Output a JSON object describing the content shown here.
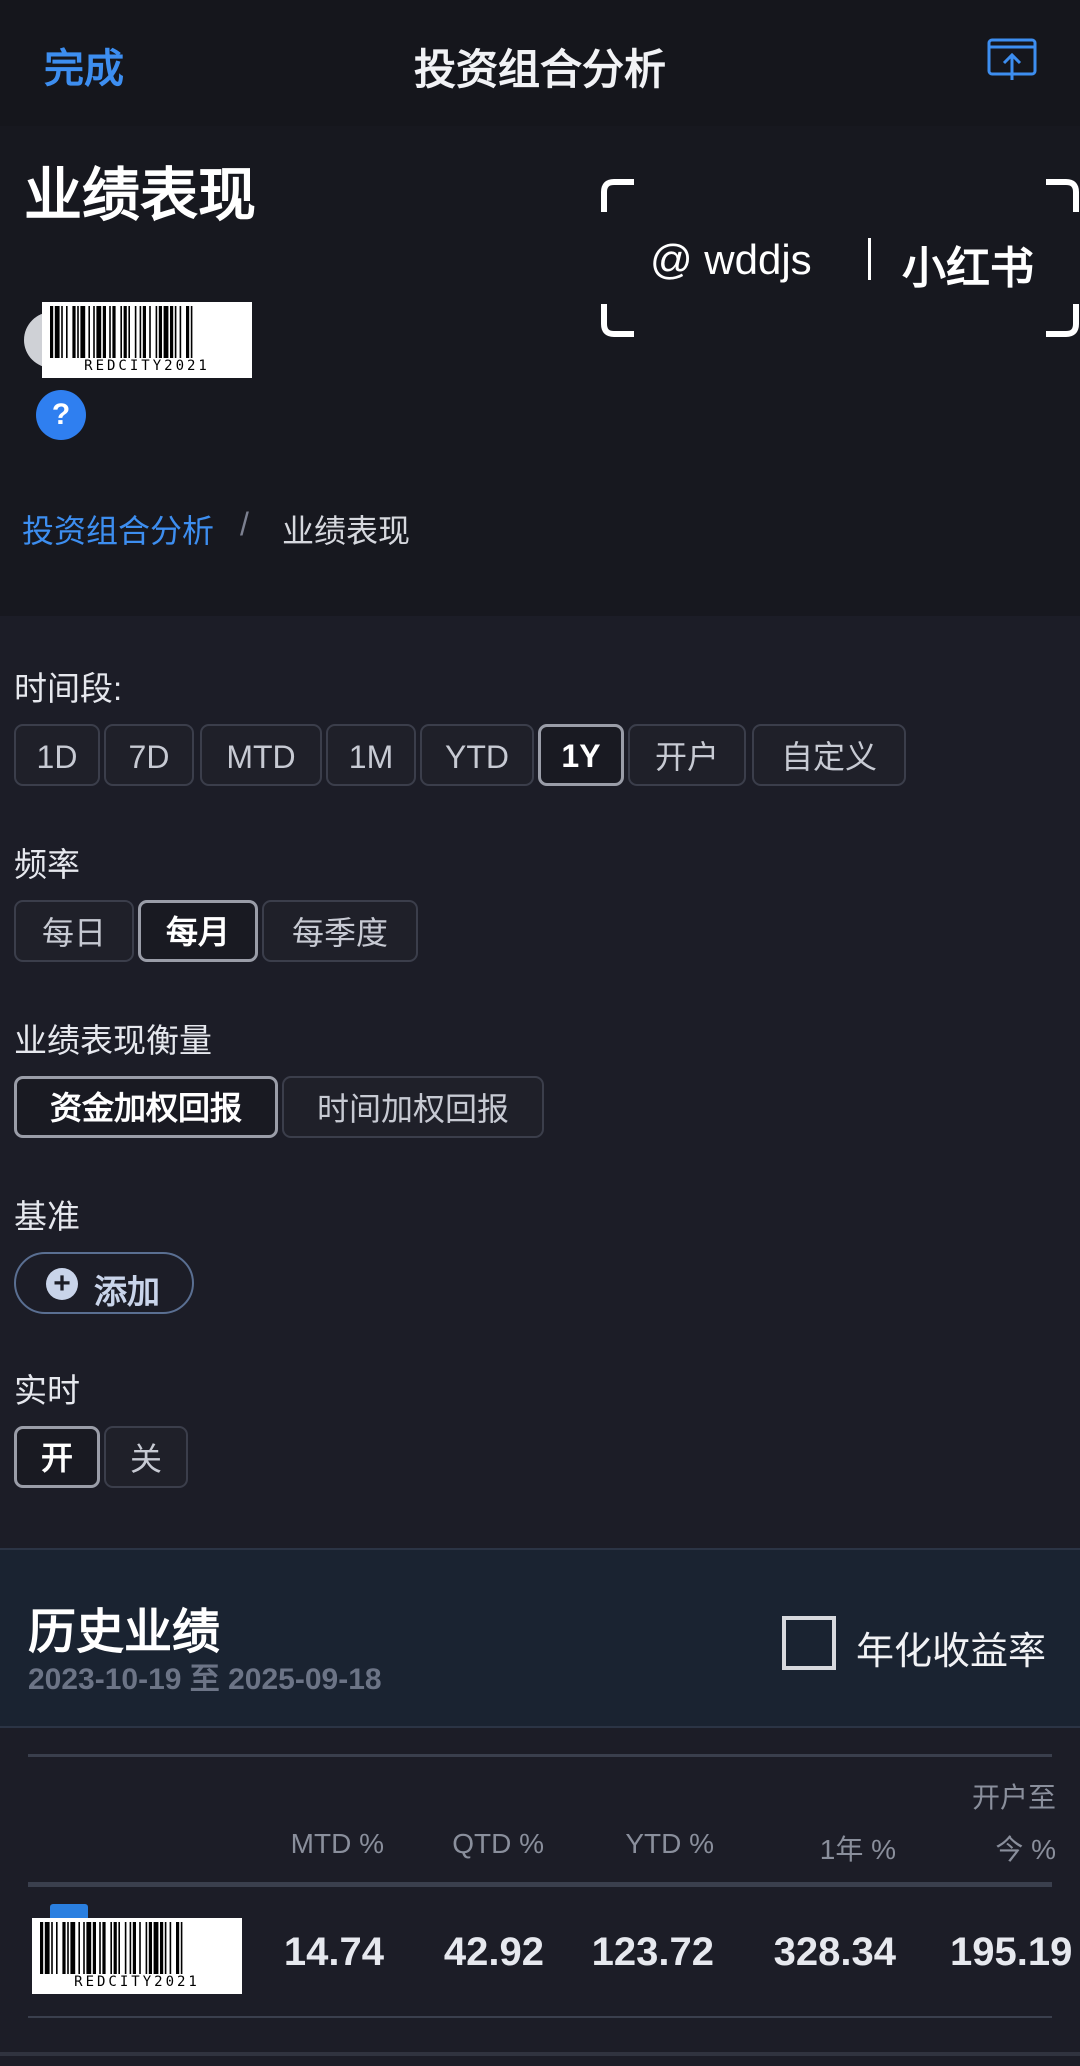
{
  "nav": {
    "done_label": "完成",
    "title": "投资组合分析",
    "share_icon": "share-screen-icon"
  },
  "header": {
    "title": "业绩表现",
    "barcode_text": "REDCITY2021",
    "help_label": "?",
    "breadcrumb": {
      "parent": "投资组合分析",
      "separator": "/",
      "current": "业绩表现"
    }
  },
  "watermark": {
    "handle": "@ wddjs",
    "brand": "小红书"
  },
  "filters": {
    "period": {
      "label": "时间段:",
      "options": [
        "1D",
        "7D",
        "MTD",
        "1M",
        "YTD",
        "1Y",
        "开户",
        "自定义"
      ],
      "selected": "1Y"
    },
    "frequency": {
      "label": "频率",
      "options": [
        "每日",
        "每月",
        "每季度"
      ],
      "selected": "每月"
    },
    "measure": {
      "label": "业绩表现衡量",
      "options": [
        "资金加权回报",
        "时间加权回报"
      ],
      "selected": "资金加权回报"
    },
    "benchmark": {
      "label": "基准",
      "add_label": "添加"
    },
    "realtime": {
      "label": "实时",
      "options": [
        "开",
        "关"
      ],
      "selected": "开"
    }
  },
  "history": {
    "title": "历史业绩",
    "range": "2023-10-19 至 2025-09-18",
    "annualized_label": "年化收益率",
    "annualized_checked": false,
    "columns": [
      "MTD %",
      "QTD %",
      "YTD %",
      "1年 %",
      "开户至",
      "今 %"
    ],
    "row": {
      "account_barcode": "REDCITY2021",
      "values": [
        "14.74",
        "42.92",
        "123.72",
        "328.34",
        "195.19"
      ]
    }
  },
  "colors": {
    "accent": "#3d8ef0",
    "background": "#1c1d27",
    "header_bg": "#17181f",
    "history_bg": "#1a2331"
  }
}
